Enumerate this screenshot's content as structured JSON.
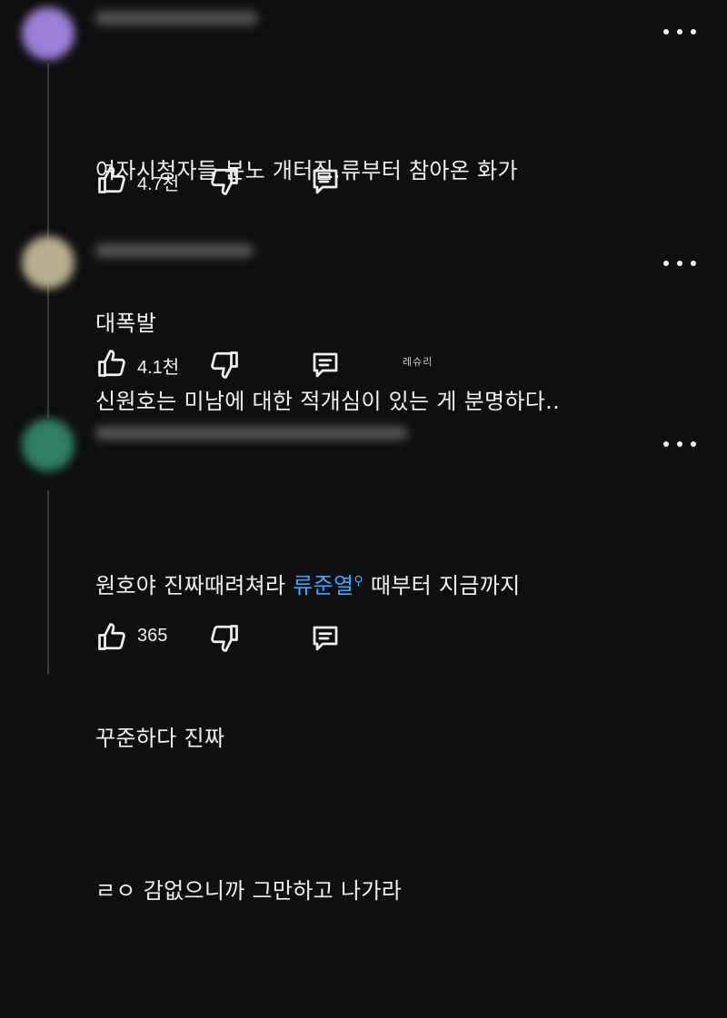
{
  "comments": [
    {
      "text_lines": [
        "여자시청자들 분노 개터짐.류부터 참아온 화가",
        "대폭발"
      ],
      "likes": "4.7천",
      "avatar_color": "#9b7fd8"
    },
    {
      "text_lines": [
        "신원호는 미남에 대한 적개심이 있는 게 분명하다.."
      ],
      "likes": "4.1천",
      "avatar_color": "#b8ad8e"
    },
    {
      "text_line1_before": "원호야 진짜때려쳐라 ",
      "mention": "류준열",
      "text_line1_after": " 때부터 지금까지",
      "text_lines_rest": [
        "꾸준하다 진짜",
        "ㄹㅇ 감없으니까 그만하고 나가라"
      ],
      "likes": "365",
      "avatar_color": "#2f7f63"
    }
  ],
  "watermark": "레슈리",
  "icons": {
    "like": "thumbs-up-icon",
    "dislike": "thumbs-down-icon",
    "reply": "reply-icon",
    "more": "more-vert-icon",
    "mention_search": "search-icon"
  },
  "colors": {
    "background": "#0f0f0f",
    "text": "#f1f1f1",
    "mention": "#3ea6ff"
  }
}
